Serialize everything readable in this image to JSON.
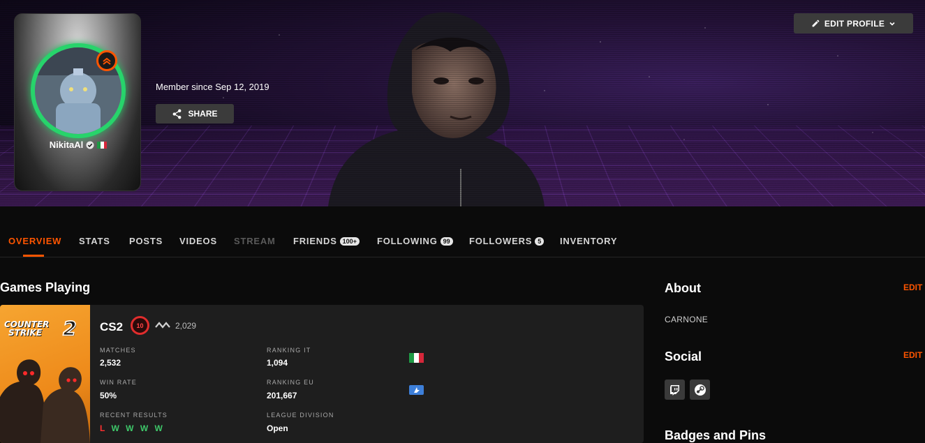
{
  "header": {
    "edit_profile_label": "EDIT PROFILE",
    "member_since": "Member since Sep 12, 2019",
    "share_label": "SHARE",
    "nickname": "NikitaAl"
  },
  "tabs": [
    {
      "label": "OVERVIEW",
      "state": "active"
    },
    {
      "label": "STATS"
    },
    {
      "label": "POSTS"
    },
    {
      "label": "VIDEOS"
    },
    {
      "label": "STREAM",
      "state": "disabled"
    },
    {
      "label": "FRIENDS",
      "count": "100+"
    },
    {
      "label": "FOLLOWING",
      "count": "99"
    },
    {
      "label": "FOLLOWERS",
      "count": "5"
    },
    {
      "label": "INVENTORY"
    }
  ],
  "games": {
    "title": "Games Playing",
    "card": {
      "art_logo_line1": "COUNTER",
      "art_logo_line2": "STRIKE",
      "art_logo_number": "2",
      "name": "CS2",
      "level": "10",
      "elo": "2,029",
      "matches_label": "MATCHES",
      "matches_value": "2,532",
      "win_rate_label": "WIN RATE",
      "win_rate_value": "50%",
      "recent_results_label": "RECENT RESULTS",
      "recent_results": [
        "L",
        "W",
        "W",
        "W",
        "W"
      ],
      "ranking_it_label": "RANKING IT",
      "ranking_it_value": "1,094",
      "ranking_eu_label": "RANKING EU",
      "ranking_eu_value": "201,667",
      "league_division_label": "LEAGUE DIVISION",
      "league_division_value": "Open"
    }
  },
  "sidebar": {
    "about_title": "About",
    "about_edit": "EDIT",
    "about_text": "CARNONE",
    "social_title": "Social",
    "social_edit": "EDIT",
    "social_links": [
      "twitch-icon",
      "steam-icon"
    ],
    "badges_title": "Badges and Pins"
  },
  "colors": {
    "accent": "#ff5500",
    "win": "#3ec86a",
    "loss": "#ff3030",
    "level_ring": "#e02d2d",
    "avatar_ring": "#27d46b"
  }
}
